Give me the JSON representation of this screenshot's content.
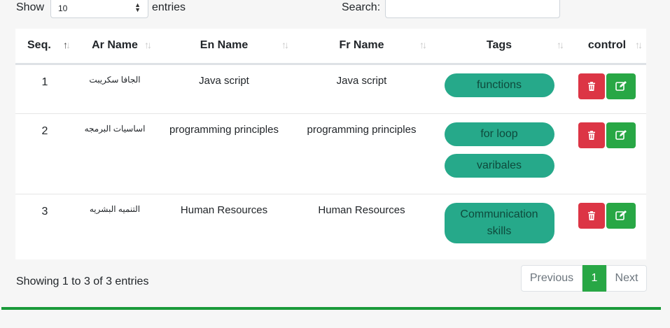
{
  "controls": {
    "show_label": "Show",
    "length_value": "10",
    "entries_label": "entries",
    "search_label": "Search:",
    "search_value": ""
  },
  "table": {
    "headers": [
      "Seq.",
      "Ar Name",
      "En Name",
      "Fr Name",
      "Tags",
      "control"
    ],
    "rows": [
      {
        "seq": "1",
        "ar": "الجافا سكريبت",
        "en": "Java script",
        "fr": "Java script",
        "tags": [
          "functions"
        ]
      },
      {
        "seq": "2",
        "ar": "اساسيات البرمجه",
        "en": "programming principles",
        "fr": "programming principles",
        "tags": [
          "for loop",
          "varibales"
        ]
      },
      {
        "seq": "3",
        "ar": "التنميه البشريه",
        "en": "Human Resources",
        "fr": "Human Resources",
        "tags": [
          "Communication skills"
        ]
      }
    ]
  },
  "footer": {
    "info": "Showing 1 to 3 of 3 entries",
    "prev": "Previous",
    "page": "1",
    "next": "Next"
  },
  "colors": {
    "tag_bg": "#26a98a",
    "delete": "#dc3545",
    "edit": "#28a745",
    "accent_line": "#1a9a3a"
  },
  "icons": {
    "delete": "trash-icon",
    "edit": "edit-icon",
    "sort": "sort-icon"
  }
}
